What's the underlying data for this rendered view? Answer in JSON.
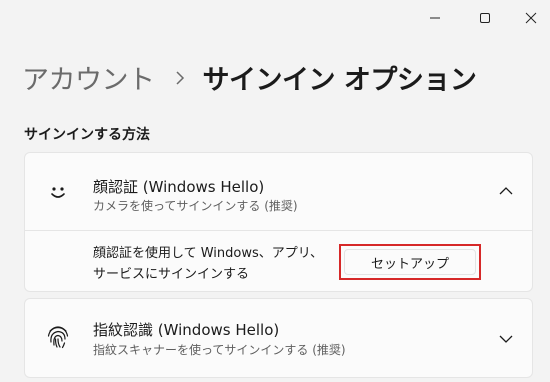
{
  "window": {
    "minimize_icon": "minimize-icon",
    "maximize_icon": "maximize-icon",
    "close_icon": "close-icon"
  },
  "breadcrumb": {
    "parent": "アカウント",
    "separator_icon": "chevron-right-icon",
    "current": "サインイン オプション"
  },
  "section": {
    "title": "サインインする方法"
  },
  "face": {
    "icon": "face-smile-icon",
    "title": "顔認証 (Windows Hello)",
    "subtitle": "カメラを使ってサインインする (推奨)",
    "expanded": true,
    "chevron_icon": "chevron-up-icon",
    "description": "顔認証を使用して Windows、アプリ、サービスにサインインする",
    "setup_label": "セットアップ"
  },
  "fingerprint": {
    "icon": "fingerprint-icon",
    "title": "指紋認識 (Windows Hello)",
    "subtitle": "指紋スキャナーを使ってサインインする (推奨)",
    "expanded": false,
    "chevron_icon": "chevron-down-icon"
  },
  "colors": {
    "highlight_border": "#d62828",
    "background": "#f3f3f3",
    "card": "#fbfbfb"
  }
}
